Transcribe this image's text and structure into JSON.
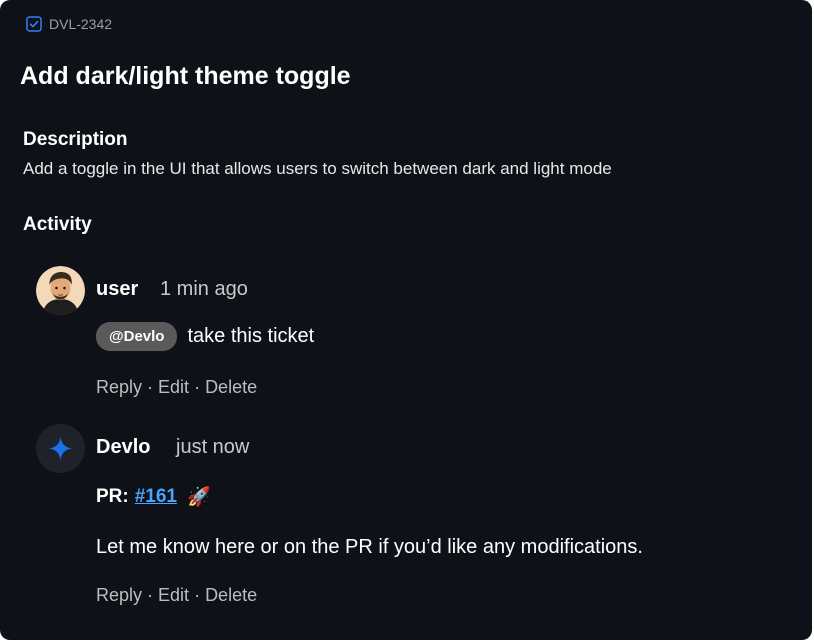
{
  "ticket": {
    "id": "DVL-2342",
    "title": "Add dark/light theme toggle"
  },
  "description": {
    "heading": "Description",
    "text": "Add a toggle in the UI that allows users to switch between dark and light mode"
  },
  "activity": {
    "heading": "Activity",
    "comments": [
      {
        "author": "user",
        "timestamp": "1 min ago",
        "mention": "@Devlo",
        "text": "take this ticket",
        "actions": {
          "reply": "Reply",
          "sep1": " · ",
          "edit": "Edit",
          "sep2": " · ",
          "delete": "Delete"
        }
      },
      {
        "author": "Devlo",
        "timestamp": "just now",
        "pr_label": "PR:",
        "pr_link": "#161",
        "pr_emoji": "🚀",
        "text": "Let me know here or on the PR if you’d like any modifications.",
        "actions": {
          "reply": "Reply",
          "sep1": " · ",
          "edit": "Edit",
          "sep2": " · ",
          "delete": "Delete"
        }
      }
    ]
  },
  "colors": {
    "background": "#0e1117",
    "link": "#4aa3ff",
    "accent_star": "#1f6feb",
    "mention_chip": "#5a5a5a"
  },
  "icons": {
    "ticket_icon": "checkbox-icon",
    "bot_icon": "sparkle-star-icon"
  }
}
